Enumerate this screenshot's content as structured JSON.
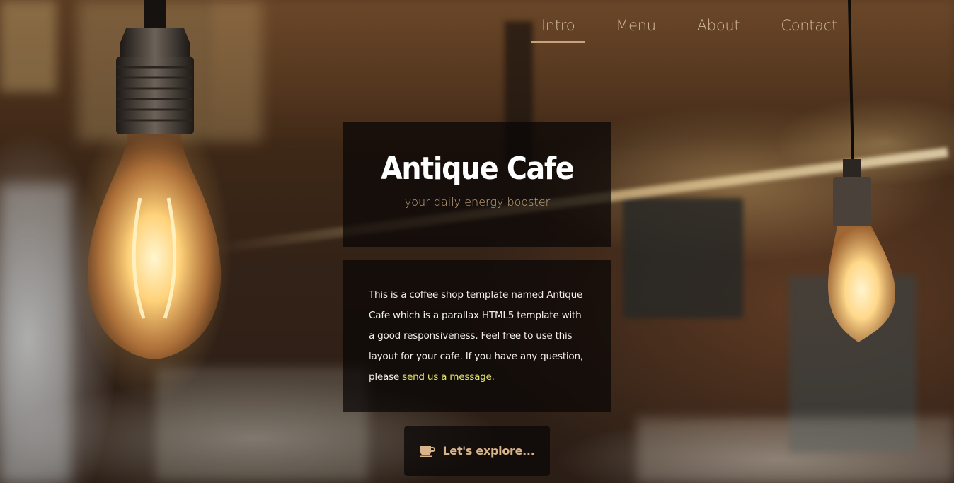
{
  "nav": {
    "items": [
      {
        "label": "Intro",
        "active": true
      },
      {
        "label": "Menu",
        "active": false
      },
      {
        "label": "About",
        "active": false
      },
      {
        "label": "Contact",
        "active": false
      }
    ]
  },
  "hero": {
    "title": "Antique Cafe",
    "tagline": "your daily energy booster"
  },
  "intro": {
    "text": "This is a coffee shop template named Antique Cafe which is a parallax HTML5 template with a good responsiveness. Feel free to use this layout for your cafe. If you have any question, please ",
    "link_text": "send us a message.",
    "link_color": "#e7e36b"
  },
  "cta": {
    "label": "Let's explore...",
    "icon": "coffee-cup-icon"
  },
  "colors": {
    "accent": "#c9a87e",
    "nav_text": "#d2b89b",
    "panel_bg": "rgba(8,6,5,0.72)"
  }
}
